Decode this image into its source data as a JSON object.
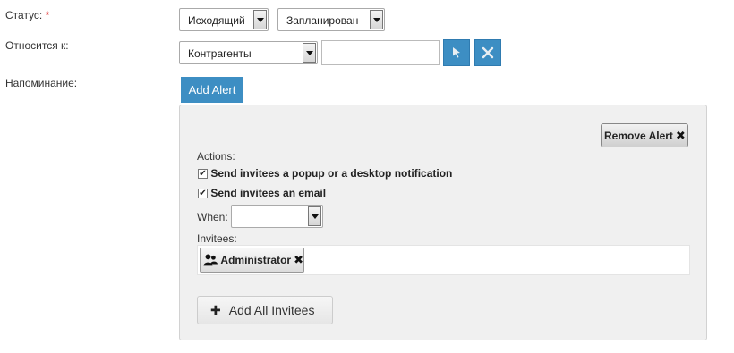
{
  "form": {
    "status": {
      "label": "Статус:",
      "required_mark": "*",
      "direction": "Исходящий",
      "state": "Запланирован"
    },
    "related": {
      "label": "Относится к:",
      "module": "Контрагенты",
      "value": ""
    },
    "reminder": {
      "label": "Напоминание:",
      "add_alert": "Add Alert"
    }
  },
  "alert": {
    "remove": "Remove Alert",
    "actions_label": "Actions:",
    "popup_label": "Send invitees a popup or a desktop notification",
    "popup_checked": true,
    "email_label": "Send invitees an email",
    "email_checked": true,
    "when_label": "When:",
    "when_value": "",
    "invitees_label": "Invitees:",
    "invitees": [
      {
        "name": "Administrator"
      }
    ],
    "add_all": "Add All Invitees"
  },
  "colors": {
    "accent": "#3d8ec3",
    "required": "#e02020"
  }
}
